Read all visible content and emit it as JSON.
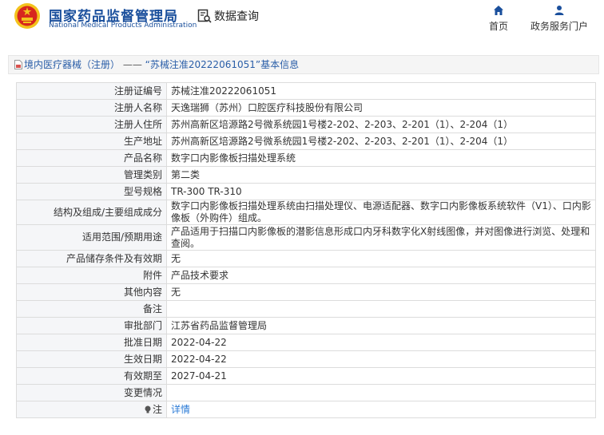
{
  "header": {
    "org_cn": "国家药品监督管理局",
    "org_en": "National Medical Products Administration",
    "query_title": "数据查询",
    "nav": {
      "home": "首页",
      "portal": "政务服务门户"
    }
  },
  "breadcrumb": {
    "link": "境内医疗器械（注册）",
    "sep": "——",
    "current": "“苏械注准20222061051”基本信息"
  },
  "rows": [
    {
      "label": "注册证编号",
      "value": "苏械注准20222061051"
    },
    {
      "label": "注册人名称",
      "value": "天逸瑞狮（苏州）口腔医疗科技股份有限公司"
    },
    {
      "label": "注册人住所",
      "value": "苏州高新区培源路2号微系统园1号楼2-202、2-203、2-201（1）、2-204（1）"
    },
    {
      "label": "生产地址",
      "value": "苏州高新区培源路2号微系统园1号楼2-202、2-203、2-201（1）、2-204（1）"
    },
    {
      "label": "产品名称",
      "value": "数字口内影像板扫描处理系统"
    },
    {
      "label": "管理类别",
      "value": "第二类"
    },
    {
      "label": "型号规格",
      "value": "TR-300 TR-310"
    },
    {
      "label": "结构及组成/主要组成成分",
      "value": "数字口内影像板扫描处理系统由扫描处理仪、电源适配器、数字口内影像板系统软件（V1）、口内影像板（外购件）组成。"
    },
    {
      "label": "适用范围/预期用途",
      "value": "产品适用于扫描口内影像板的潜影信息形成口内牙科数字化X射线图像，并对图像进行浏览、处理和查阅。"
    },
    {
      "label": "产品储存条件及有效期",
      "value": "无"
    },
    {
      "label": "附件",
      "value": "产品技术要求"
    },
    {
      "label": "其他内容",
      "value": "无"
    },
    {
      "label": "备注",
      "value": ""
    },
    {
      "label": "审批部门",
      "value": "江苏省药品监督管理局"
    },
    {
      "label": "批准日期",
      "value": "2022-04-22"
    },
    {
      "label": "生效日期",
      "value": "2022-04-22"
    },
    {
      "label": "有效期至",
      "value": "2027-04-21"
    },
    {
      "label": "变更情况",
      "value": ""
    }
  ],
  "note": {
    "label": "注",
    "link": "详情"
  },
  "colors": {
    "brand_blue": "#1a4f9c",
    "link_blue": "#2a7ad6",
    "label_bg": "#f5f6f8"
  }
}
